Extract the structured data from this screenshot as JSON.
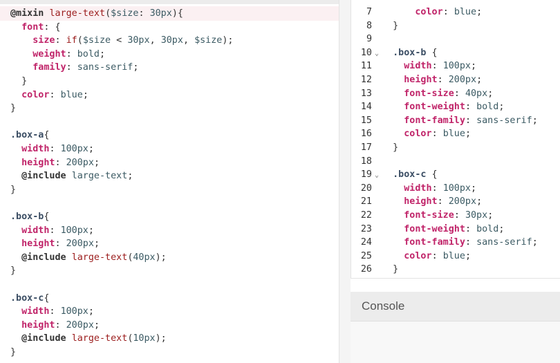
{
  "left_editor": {
    "lines": [
      [
        {
          "t": "@mixin ",
          "c": "k"
        },
        {
          "t": "large-text",
          "c": "fn"
        },
        {
          "t": "(",
          "c": "pun"
        },
        {
          "t": "$size",
          "c": "var"
        },
        {
          "t": ": ",
          "c": "pun"
        },
        {
          "t": "30px",
          "c": "val"
        },
        {
          "t": "){",
          "c": "pun"
        }
      ],
      [
        {
          "t": "  font",
          "c": "prop"
        },
        {
          "t": ": {",
          "c": "pun"
        }
      ],
      [
        {
          "t": "    size",
          "c": "prop"
        },
        {
          "t": ": ",
          "c": "pun"
        },
        {
          "t": "if",
          "c": "fn"
        },
        {
          "t": "(",
          "c": "pun"
        },
        {
          "t": "$size",
          "c": "var"
        },
        {
          "t": " < ",
          "c": "pun"
        },
        {
          "t": "30px",
          "c": "val"
        },
        {
          "t": ", ",
          "c": "pun"
        },
        {
          "t": "30px",
          "c": "val"
        },
        {
          "t": ", ",
          "c": "pun"
        },
        {
          "t": "$size",
          "c": "var"
        },
        {
          "t": ");",
          "c": "pun"
        }
      ],
      [
        {
          "t": "    weight",
          "c": "prop"
        },
        {
          "t": ": ",
          "c": "pun"
        },
        {
          "t": "bold",
          "c": "val"
        },
        {
          "t": ";",
          "c": "pun"
        }
      ],
      [
        {
          "t": "    family",
          "c": "prop"
        },
        {
          "t": ": ",
          "c": "pun"
        },
        {
          "t": "sans-serif",
          "c": "val"
        },
        {
          "t": ";",
          "c": "pun"
        }
      ],
      [
        {
          "t": "  }",
          "c": "pun"
        }
      ],
      [
        {
          "t": "  color",
          "c": "prop"
        },
        {
          "t": ": ",
          "c": "pun"
        },
        {
          "t": "blue",
          "c": "val"
        },
        {
          "t": ";",
          "c": "pun"
        }
      ],
      [
        {
          "t": "}",
          "c": "pun"
        }
      ],
      [],
      [
        {
          "t": ".box-a",
          "c": "sel"
        },
        {
          "t": "{",
          "c": "pun"
        }
      ],
      [
        {
          "t": "  width",
          "c": "prop"
        },
        {
          "t": ": ",
          "c": "pun"
        },
        {
          "t": "100px",
          "c": "val"
        },
        {
          "t": ";",
          "c": "pun"
        }
      ],
      [
        {
          "t": "  height",
          "c": "prop"
        },
        {
          "t": ": ",
          "c": "pun"
        },
        {
          "t": "200px",
          "c": "val"
        },
        {
          "t": ";",
          "c": "pun"
        }
      ],
      [
        {
          "t": "  @include ",
          "c": "k"
        },
        {
          "t": "large-text",
          "c": "val"
        },
        {
          "t": ";",
          "c": "pun"
        }
      ],
      [
        {
          "t": "}",
          "c": "pun"
        }
      ],
      [],
      [
        {
          "t": ".box-b",
          "c": "sel"
        },
        {
          "t": "{",
          "c": "pun"
        }
      ],
      [
        {
          "t": "  width",
          "c": "prop"
        },
        {
          "t": ": ",
          "c": "pun"
        },
        {
          "t": "100px",
          "c": "val"
        },
        {
          "t": ";",
          "c": "pun"
        }
      ],
      [
        {
          "t": "  height",
          "c": "prop"
        },
        {
          "t": ": ",
          "c": "pun"
        },
        {
          "t": "200px",
          "c": "val"
        },
        {
          "t": ";",
          "c": "pun"
        }
      ],
      [
        {
          "t": "  @include ",
          "c": "k"
        },
        {
          "t": "large-text",
          "c": "fn"
        },
        {
          "t": "(",
          "c": "pun"
        },
        {
          "t": "40px",
          "c": "val"
        },
        {
          "t": ");",
          "c": "pun"
        }
      ],
      [
        {
          "t": "}",
          "c": "pun"
        }
      ],
      [],
      [
        {
          "t": ".box-c",
          "c": "sel"
        },
        {
          "t": "{",
          "c": "pun"
        }
      ],
      [
        {
          "t": "  width",
          "c": "prop"
        },
        {
          "t": ": ",
          "c": "pun"
        },
        {
          "t": "100px",
          "c": "val"
        },
        {
          "t": ";",
          "c": "pun"
        }
      ],
      [
        {
          "t": "  height",
          "c": "prop"
        },
        {
          "t": ": ",
          "c": "pun"
        },
        {
          "t": "200px",
          "c": "val"
        },
        {
          "t": ";",
          "c": "pun"
        }
      ],
      [
        {
          "t": "  @include ",
          "c": "k"
        },
        {
          "t": "large-text",
          "c": "fn"
        },
        {
          "t": "(",
          "c": "pun"
        },
        {
          "t": "10px",
          "c": "val"
        },
        {
          "t": ");",
          "c": "pun"
        }
      ],
      [
        {
          "t": "}",
          "c": "pun"
        }
      ]
    ]
  },
  "right_editor": {
    "lines": [
      {
        "num": "7",
        "fold": false,
        "tokens": [
          {
            "t": "      color",
            "c": "prop"
          },
          {
            "t": ": ",
            "c": "pun"
          },
          {
            "t": "blue",
            "c": "val"
          },
          {
            "t": ";",
            "c": "pun"
          }
        ]
      },
      {
        "num": "8",
        "fold": false,
        "tokens": [
          {
            "t": "  }",
            "c": "pun"
          }
        ]
      },
      {
        "num": "9",
        "fold": false,
        "tokens": []
      },
      {
        "num": "10",
        "fold": true,
        "tokens": [
          {
            "t": "  .box-b",
            "c": "sel"
          },
          {
            "t": " {",
            "c": "pun"
          }
        ]
      },
      {
        "num": "11",
        "fold": false,
        "tokens": [
          {
            "t": "    width",
            "c": "prop"
          },
          {
            "t": ": ",
            "c": "pun"
          },
          {
            "t": "100px",
            "c": "val"
          },
          {
            "t": ";",
            "c": "pun"
          }
        ]
      },
      {
        "num": "12",
        "fold": false,
        "tokens": [
          {
            "t": "    height",
            "c": "prop"
          },
          {
            "t": ": ",
            "c": "pun"
          },
          {
            "t": "200px",
            "c": "val"
          },
          {
            "t": ";",
            "c": "pun"
          }
        ]
      },
      {
        "num": "13",
        "fold": false,
        "tokens": [
          {
            "t": "    font-size",
            "c": "prop"
          },
          {
            "t": ": ",
            "c": "pun"
          },
          {
            "t": "40px",
            "c": "val"
          },
          {
            "t": ";",
            "c": "pun"
          }
        ]
      },
      {
        "num": "14",
        "fold": false,
        "tokens": [
          {
            "t": "    font-weight",
            "c": "prop"
          },
          {
            "t": ": ",
            "c": "pun"
          },
          {
            "t": "bold",
            "c": "val"
          },
          {
            "t": ";",
            "c": "pun"
          }
        ]
      },
      {
        "num": "15",
        "fold": false,
        "tokens": [
          {
            "t": "    font-family",
            "c": "prop"
          },
          {
            "t": ": ",
            "c": "pun"
          },
          {
            "t": "sans-serif",
            "c": "val"
          },
          {
            "t": ";",
            "c": "pun"
          }
        ]
      },
      {
        "num": "16",
        "fold": false,
        "tokens": [
          {
            "t": "    color",
            "c": "prop"
          },
          {
            "t": ": ",
            "c": "pun"
          },
          {
            "t": "blue",
            "c": "val"
          },
          {
            "t": ";",
            "c": "pun"
          }
        ]
      },
      {
        "num": "17",
        "fold": false,
        "tokens": [
          {
            "t": "  }",
            "c": "pun"
          }
        ]
      },
      {
        "num": "18",
        "fold": false,
        "tokens": []
      },
      {
        "num": "19",
        "fold": true,
        "tokens": [
          {
            "t": "  .box-c",
            "c": "sel"
          },
          {
            "t": " {",
            "c": "pun"
          }
        ]
      },
      {
        "num": "20",
        "fold": false,
        "tokens": [
          {
            "t": "    width",
            "c": "prop"
          },
          {
            "t": ": ",
            "c": "pun"
          },
          {
            "t": "100px",
            "c": "val"
          },
          {
            "t": ";",
            "c": "pun"
          }
        ]
      },
      {
        "num": "21",
        "fold": false,
        "tokens": [
          {
            "t": "    height",
            "c": "prop"
          },
          {
            "t": ": ",
            "c": "pun"
          },
          {
            "t": "200px",
            "c": "val"
          },
          {
            "t": ";",
            "c": "pun"
          }
        ]
      },
      {
        "num": "22",
        "fold": false,
        "tokens": [
          {
            "t": "    font-size",
            "c": "prop"
          },
          {
            "t": ": ",
            "c": "pun"
          },
          {
            "t": "30px",
            "c": "val"
          },
          {
            "t": ";",
            "c": "pun"
          }
        ]
      },
      {
        "num": "23",
        "fold": false,
        "tokens": [
          {
            "t": "    font-weight",
            "c": "prop"
          },
          {
            "t": ": ",
            "c": "pun"
          },
          {
            "t": "bold",
            "c": "val"
          },
          {
            "t": ";",
            "c": "pun"
          }
        ]
      },
      {
        "num": "24",
        "fold": false,
        "tokens": [
          {
            "t": "    font-family",
            "c": "prop"
          },
          {
            "t": ": ",
            "c": "pun"
          },
          {
            "t": "sans-serif",
            "c": "val"
          },
          {
            "t": ";",
            "c": "pun"
          }
        ]
      },
      {
        "num": "25",
        "fold": false,
        "tokens": [
          {
            "t": "    color",
            "c": "prop"
          },
          {
            "t": ": ",
            "c": "pun"
          },
          {
            "t": "blue",
            "c": "val"
          },
          {
            "t": ";",
            "c": "pun"
          }
        ]
      },
      {
        "num": "26",
        "fold": false,
        "tokens": [
          {
            "t": "  }",
            "c": "pun"
          }
        ]
      }
    ]
  },
  "console": {
    "title": "Console"
  },
  "fold_icon": "chevron-down-icon"
}
